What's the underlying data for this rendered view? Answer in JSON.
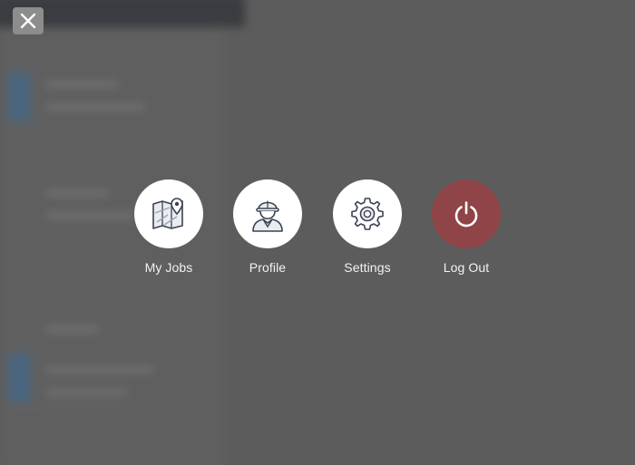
{
  "overlay": {
    "close_icon": "close-icon",
    "menu_items": [
      {
        "label": "My Jobs",
        "icon": "map-pin-icon"
      },
      {
        "label": "Profile",
        "icon": "worker-avatar-icon"
      },
      {
        "label": "Settings",
        "icon": "gear-icon"
      },
      {
        "label": "Log Out",
        "icon": "power-icon"
      }
    ]
  },
  "colors": {
    "overlay_bg": "#5c5c5c",
    "circle_bg": "#ffffff",
    "logout_bg": "#8f4447",
    "icon_stroke": "#3b4252",
    "label_text": "#f2f2f2"
  }
}
